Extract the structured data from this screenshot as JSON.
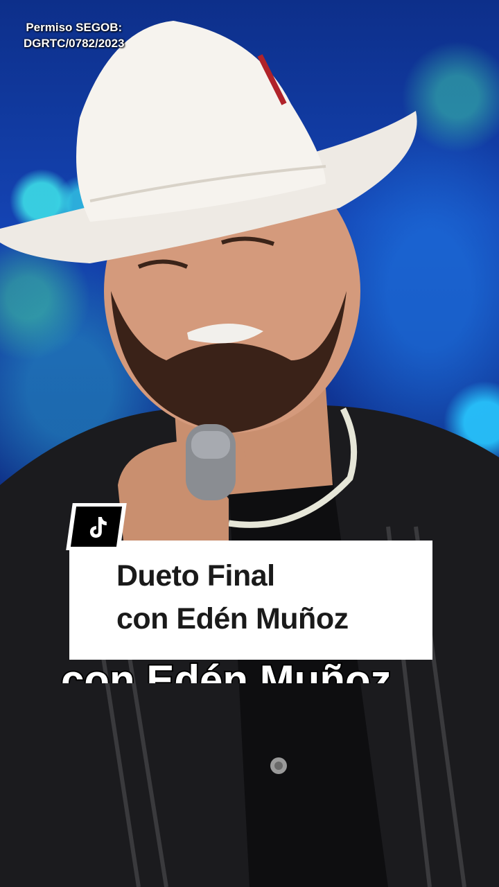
{
  "video": {
    "watermark_line1": "Permiso SEGOB:",
    "watermark_line2": "DGRTC/0782/2023"
  },
  "caption": {
    "icon": "tiktok-logo-icon",
    "line1": "Dueto Final",
    "line2": "con Edén Muñoz",
    "echo": "con Edén Muñoz"
  },
  "colors": {
    "stage_blue": "#1443b2",
    "caption_bg": "#ffffff",
    "caption_text": "#1a1a1a",
    "badge_bg": "#000000"
  }
}
